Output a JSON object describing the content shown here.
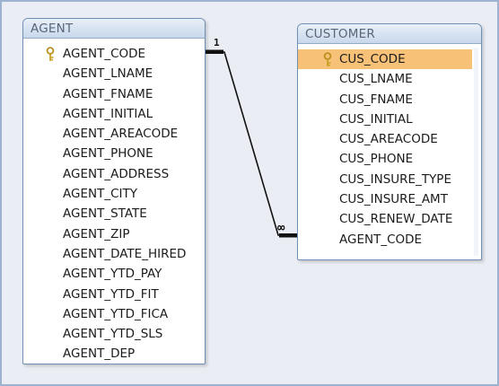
{
  "agent_table": {
    "title": "AGENT",
    "fields": [
      {
        "label": "AGENT_CODE",
        "primary_key": true
      },
      {
        "label": "AGENT_LNAME"
      },
      {
        "label": "AGENT_FNAME"
      },
      {
        "label": "AGENT_INITIAL"
      },
      {
        "label": "AGENT_AREACODE"
      },
      {
        "label": "AGENT_PHONE"
      },
      {
        "label": "AGENT_ADDRESS"
      },
      {
        "label": "AGENT_CITY"
      },
      {
        "label": "AGENT_STATE"
      },
      {
        "label": "AGENT_ZIP"
      },
      {
        "label": "AGENT_DATE_HIRED"
      },
      {
        "label": "AGENT_YTD_PAY"
      },
      {
        "label": "AGENT_YTD_FIT"
      },
      {
        "label": "AGENT_YTD_FICA"
      },
      {
        "label": "AGENT_YTD_SLS"
      },
      {
        "label": "AGENT_DEP"
      }
    ]
  },
  "customer_table": {
    "title": "CUSTOMER",
    "fields": [
      {
        "label": "CUS_CODE",
        "primary_key": true,
        "selected": true
      },
      {
        "label": "CUS_LNAME"
      },
      {
        "label": "CUS_FNAME"
      },
      {
        "label": "CUS_INITIAL"
      },
      {
        "label": "CUS_AREACODE"
      },
      {
        "label": "CUS_PHONE"
      },
      {
        "label": "CUS_INSURE_TYPE"
      },
      {
        "label": "CUS_INSURE_AMT"
      },
      {
        "label": "CUS_RENEW_DATE"
      },
      {
        "label": "AGENT_CODE"
      }
    ]
  },
  "relationship": {
    "one_side_label": "1",
    "many_side_label": "∞",
    "from": "AGENT.AGENT_CODE",
    "to": "CUSTOMER.AGENT_CODE"
  },
  "colors": {
    "canvas_background": "#eaeef4",
    "title_bar": "#d6e2f1",
    "window_border": "#6f8fb6",
    "selected_row": "#f7c177",
    "key_icon": "#c9a227",
    "relationship_line": "#111111"
  },
  "icons": {
    "primary_key": "key-icon"
  }
}
